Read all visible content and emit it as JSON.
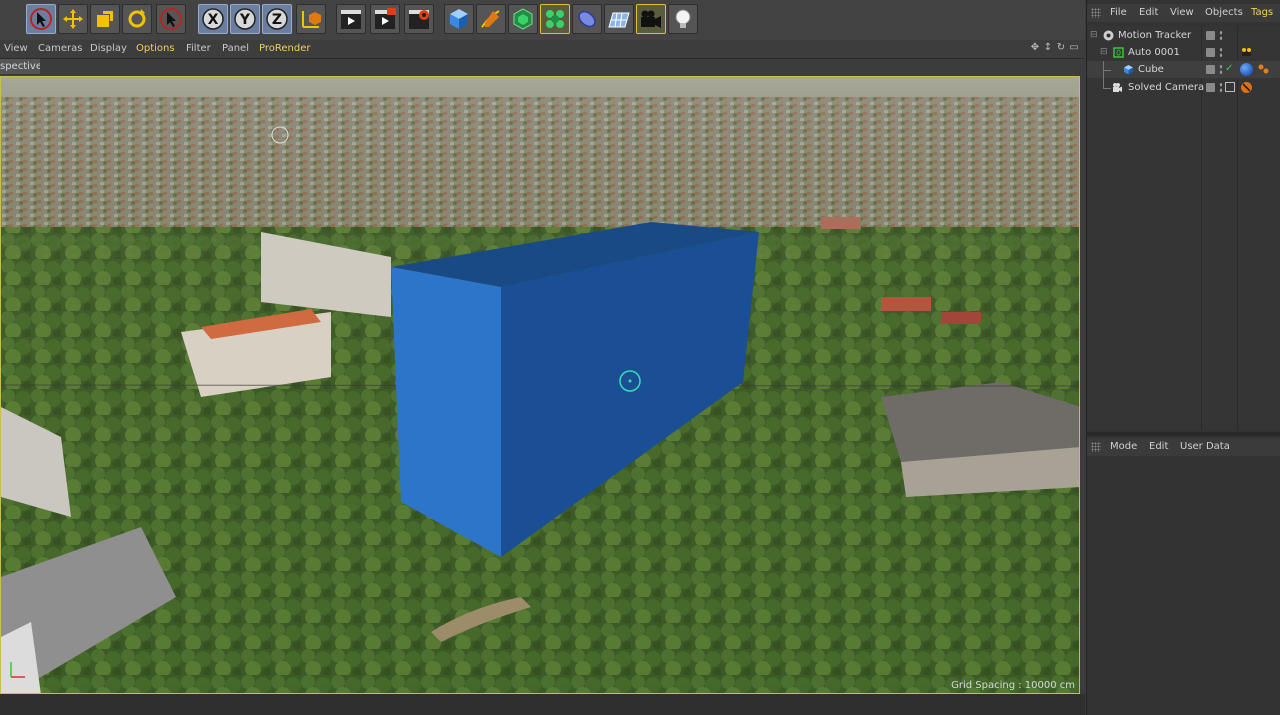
{
  "toolbar": {
    "tools": [
      {
        "name": "live-selection-icon",
        "state": "active"
      },
      {
        "name": "move-icon",
        "state": "normal"
      },
      {
        "name": "scale-icon",
        "state": "normal"
      },
      {
        "name": "rotate-icon",
        "state": "normal"
      },
      {
        "name": "recent-tool-icon",
        "state": "normal"
      },
      {
        "name": "x-axis-lock-icon",
        "label": "X",
        "state": "active"
      },
      {
        "name": "y-axis-lock-icon",
        "label": "Y",
        "state": "active"
      },
      {
        "name": "z-axis-lock-icon",
        "label": "Z",
        "state": "active"
      },
      {
        "name": "coordinate-system-icon",
        "state": "normal"
      },
      {
        "name": "render-view-icon",
        "state": "normal"
      },
      {
        "name": "render-picture-viewer-icon",
        "state": "normal"
      },
      {
        "name": "render-settings-icon",
        "state": "normal"
      },
      {
        "name": "cube-object-icon",
        "state": "normal"
      },
      {
        "name": "pen-spline-icon",
        "state": "normal"
      },
      {
        "name": "subdivision-icon",
        "state": "normal"
      },
      {
        "name": "cloner-icon",
        "state": "highlight"
      },
      {
        "name": "deformer-icon",
        "state": "normal"
      },
      {
        "name": "floor-icon",
        "state": "normal"
      },
      {
        "name": "camera-icon",
        "state": "highlight"
      },
      {
        "name": "light-icon",
        "state": "normal"
      }
    ]
  },
  "viewport_menu": {
    "items": [
      "View",
      "Cameras",
      "Display",
      "Options",
      "Filter",
      "Panel",
      "ProRender"
    ],
    "highlighted": [
      "Options",
      "ProRender"
    ]
  },
  "viewport": {
    "camera_label": "spective",
    "grid_spacing": "Grid Spacing : 10000 cm"
  },
  "object_manager": {
    "menu": [
      "File",
      "Edit",
      "View",
      "Objects",
      "Tags"
    ],
    "highlighted": [
      "Tags"
    ],
    "objects": [
      {
        "label": "Motion Tracker",
        "icon": "motion-tracker-icon"
      },
      {
        "label": "Auto 0001",
        "icon": "null-object-icon"
      },
      {
        "label": "Cube",
        "icon": "cube-object-icon"
      },
      {
        "label": "Solved Camera",
        "icon": "solved-camera-icon"
      }
    ]
  },
  "attribute_manager": {
    "menu": [
      "Mode",
      "Edit",
      "User Data"
    ]
  },
  "colors": {
    "cube_front": "#1a4f95",
    "cube_side": "#2c75c8",
    "cube_top": "#1a4a86",
    "viewport_border": "#c8c04a",
    "highlight_text": "#f0d060"
  }
}
